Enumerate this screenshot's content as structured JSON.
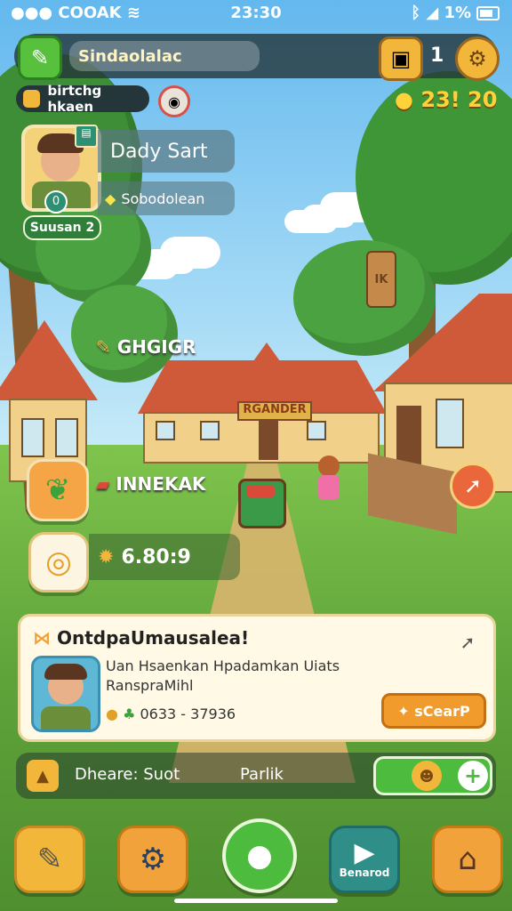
{
  "status": {
    "carrier": "COOAK",
    "time": "23:30",
    "battery": "1%"
  },
  "topbar": {
    "back_icon": "wrench-icon",
    "search_value": "Sindaolalac",
    "inventory_count": "1"
  },
  "currency": {
    "gold": "23! 20"
  },
  "player": {
    "tag": "birtchg hkaen",
    "name": "Dady Sart",
    "subtitle": "Sobodolean",
    "level_label": "Suusan",
    "level_num": "2",
    "badge": "0"
  },
  "map": {
    "sign": "GHGIGR",
    "house_banner": "RGANDER",
    "quest_label": "INNEKAK",
    "score_label": "6.80:9"
  },
  "notice": {
    "title": "OntdpaUmausalea!",
    "line1": "Uan Hsaenkan Hpadamkan Uiats",
    "line2": "RanspraMihl",
    "coin_value": "0633 - 37936",
    "action_label": "sCearP"
  },
  "quickbar": {
    "left_label": "Dheare: Suot",
    "right_label": "Parlik"
  },
  "dock": {
    "play_label": "Benarod"
  },
  "colors": {
    "accent_green": "#4cbb3e",
    "accent_orange": "#f29b2d",
    "panel_dark": "#24363a"
  }
}
